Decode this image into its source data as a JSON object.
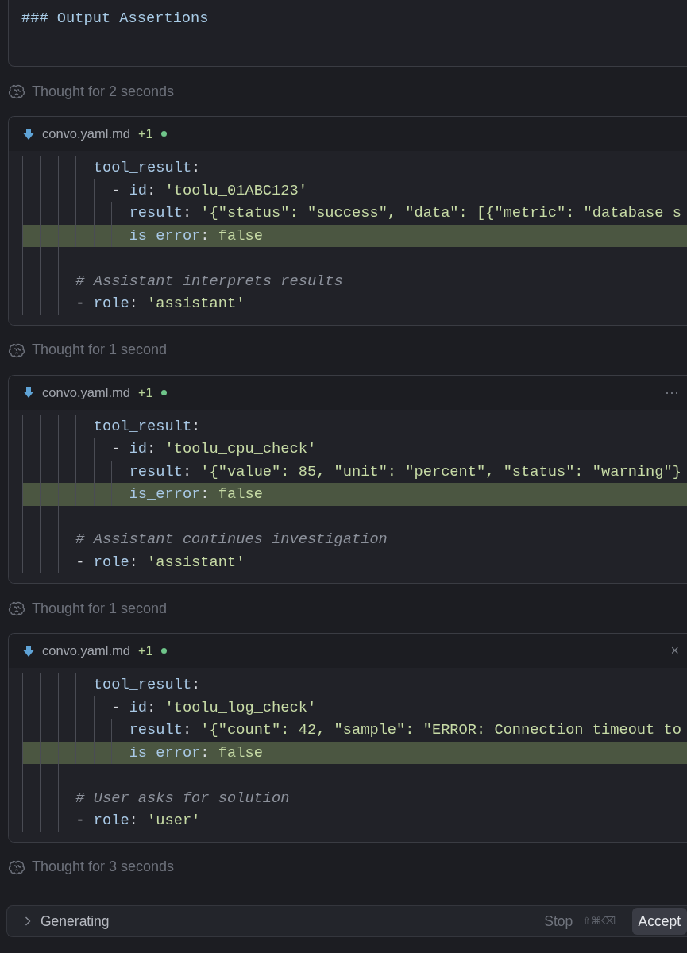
{
  "top_card": {
    "heading": "### Output Assertions"
  },
  "sections": [
    {
      "thought": "Thought for 2 seconds",
      "file": {
        "name": "convo.yaml.md",
        "changes": "+1",
        "lines": [
          {
            "children": [
              {
                "highlighted": false,
                "tokens": [
                  {
                    "kind": "key",
                    "text": "tool_result"
                  },
                  {
                    "kind": "punct",
                    "text": ":"
                  }
                ],
                "children": [
                  {
                    "highlighted": false,
                    "tokens": [
                      {
                        "kind": "punct",
                        "text": "- "
                      },
                      {
                        "kind": "key",
                        "text": "id"
                      },
                      {
                        "kind": "punct",
                        "text": ": "
                      },
                      {
                        "kind": "string",
                        "text": "'toolu_01ABC123'"
                      }
                    ],
                    "children": [
                      {
                        "highlighted": false,
                        "tokens": [
                          {
                            "kind": "key",
                            "text": "result"
                          },
                          {
                            "kind": "punct",
                            "text": ": "
                          },
                          {
                            "kind": "string",
                            "text": "'{\"status\": \"success\", \"data\": [{\"metric\": \"database_s"
                          }
                        ]
                      },
                      {
                        "highlighted": true,
                        "tokens": [
                          {
                            "kind": "key",
                            "text": "is_error"
                          },
                          {
                            "kind": "punct",
                            "text": ": "
                          },
                          {
                            "kind": "keyword",
                            "text": "false"
                          }
                        ]
                      }
                    ]
                  }
                ]
              }
            ]
          },
          {
            "highlighted": false
          },
          {
            "highlighted": false,
            "tokens": [
              {
                "kind": "comment",
                "text": "# Assistant interprets results"
              }
            ]
          },
          {
            "highlighted": false,
            "tokens": [
              {
                "kind": "punct",
                "text": "- "
              },
              {
                "kind": "key",
                "text": "role"
              },
              {
                "kind": "punct",
                "text": ": "
              },
              {
                "kind": "string",
                "text": "'assistant'"
              }
            ]
          }
        ]
      }
    },
    {
      "thought": "Thought for 1 second",
      "file": {
        "name": "convo.yaml.md",
        "changes": "+1",
        "action_icon": "···",
        "lines": [
          {
            "children": [
              {
                "highlighted": false,
                "tokens": [
                  {
                    "kind": "key",
                    "text": "tool_result"
                  },
                  {
                    "kind": "punct",
                    "text": ":"
                  }
                ],
                "children": [
                  {
                    "highlighted": false,
                    "tokens": [
                      {
                        "kind": "punct",
                        "text": "- "
                      },
                      {
                        "kind": "key",
                        "text": "id"
                      },
                      {
                        "kind": "punct",
                        "text": ": "
                      },
                      {
                        "kind": "string",
                        "text": "'toolu_cpu_check'"
                      }
                    ],
                    "children": [
                      {
                        "highlighted": false,
                        "tokens": [
                          {
                            "kind": "key",
                            "text": "result"
                          },
                          {
                            "kind": "punct",
                            "text": ": "
                          },
                          {
                            "kind": "string",
                            "text": "'{\"value\": 85, \"unit\": \"percent\", \"status\": \"warning\"}"
                          }
                        ]
                      },
                      {
                        "highlighted": true,
                        "tokens": [
                          {
                            "kind": "key",
                            "text": "is_error"
                          },
                          {
                            "kind": "punct",
                            "text": ": "
                          },
                          {
                            "kind": "keyword",
                            "text": "false"
                          }
                        ]
                      }
                    ]
                  }
                ]
              }
            ]
          },
          {
            "highlighted": false
          },
          {
            "highlighted": false,
            "tokens": [
              {
                "kind": "comment",
                "text": "# Assistant continues investigation"
              }
            ]
          },
          {
            "highlighted": false,
            "tokens": [
              {
                "kind": "punct",
                "text": "- "
              },
              {
                "kind": "key",
                "text": "role"
              },
              {
                "kind": "punct",
                "text": ": "
              },
              {
                "kind": "string",
                "text": "'assistant'"
              }
            ]
          }
        ]
      }
    },
    {
      "thought": "Thought for 1 second",
      "file": {
        "name": "convo.yaml.md",
        "changes": "+1",
        "action_icon": "×",
        "lines": [
          {
            "children": [
              {
                "highlighted": false,
                "tokens": [
                  {
                    "kind": "key",
                    "text": "tool_result"
                  },
                  {
                    "kind": "punct",
                    "text": ":"
                  }
                ],
                "children": [
                  {
                    "highlighted": false,
                    "tokens": [
                      {
                        "kind": "punct",
                        "text": "- "
                      },
                      {
                        "kind": "key",
                        "text": "id"
                      },
                      {
                        "kind": "punct",
                        "text": ": "
                      },
                      {
                        "kind": "string",
                        "text": "'toolu_log_check'"
                      }
                    ],
                    "children": [
                      {
                        "highlighted": false,
                        "tokens": [
                          {
                            "kind": "key",
                            "text": "result"
                          },
                          {
                            "kind": "punct",
                            "text": ": "
                          },
                          {
                            "kind": "string",
                            "text": "'{\"count\": 42, \"sample\": \"ERROR: Connection timeout to"
                          }
                        ]
                      },
                      {
                        "highlighted": true,
                        "tokens": [
                          {
                            "kind": "key",
                            "text": "is_error"
                          },
                          {
                            "kind": "punct",
                            "text": ": "
                          },
                          {
                            "kind": "keyword",
                            "text": "false"
                          }
                        ]
                      }
                    ]
                  }
                ]
              }
            ]
          },
          {
            "highlighted": false
          },
          {
            "highlighted": false,
            "tokens": [
              {
                "kind": "comment",
                "text": "# User asks for solution"
              }
            ]
          },
          {
            "highlighted": false,
            "tokens": [
              {
                "kind": "punct",
                "text": "- "
              },
              {
                "kind": "key",
                "text": "role"
              },
              {
                "kind": "punct",
                "text": ": "
              },
              {
                "kind": "string",
                "text": "'user'"
              }
            ]
          }
        ]
      }
    },
    {
      "thought": "Thought for 3 seconds"
    }
  ],
  "status_bar": {
    "label": "Generating",
    "stop": "Stop",
    "stop_shortcut": "⇧⌘⌫",
    "accept": "Accept"
  }
}
